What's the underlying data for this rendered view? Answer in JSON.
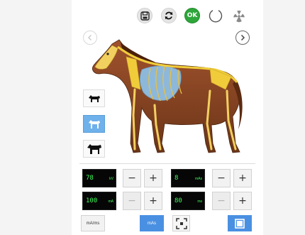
{
  "toolbar": {
    "save_icon": "save-icon",
    "refresh_icon": "refresh-icon",
    "ok_label": "OK",
    "power_icon": "power-icon",
    "radiation_icon": "radiation-icon"
  },
  "nav": {
    "prev_icon": "chevron-left-icon",
    "next_icon": "chevron-right-icon"
  },
  "views": [
    {
      "name": "horse-small-view",
      "active": false
    },
    {
      "name": "horse-skeleton-view",
      "active": true
    },
    {
      "name": "horse-large-view",
      "active": false
    }
  ],
  "exposure": {
    "kv": {
      "value": "78",
      "unit": "kV"
    },
    "mas_top": {
      "value": "8",
      "unit": "mAs"
    },
    "ma": {
      "value": "100",
      "unit": "mA"
    },
    "ms": {
      "value": "80",
      "unit": "ms"
    }
  },
  "bottom": {
    "mams_label": "mA/ms",
    "mas_label": "mAs"
  },
  "colors": {
    "accent_blue": "#4a90e2",
    "lcd_green": "#3cff5c",
    "ok_green": "#2ea63a"
  }
}
